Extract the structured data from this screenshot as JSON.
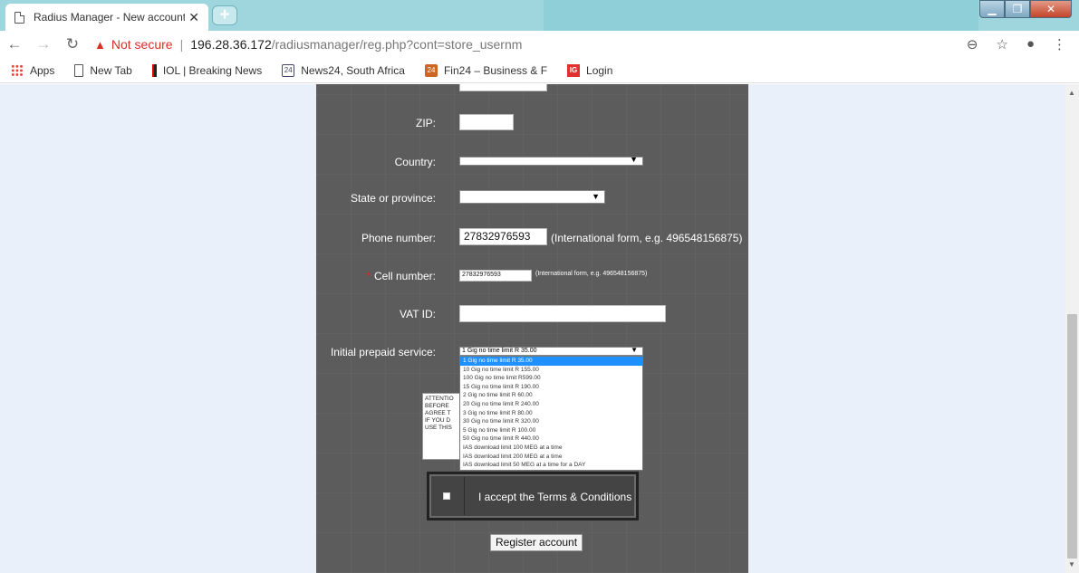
{
  "browser": {
    "tab_title": "Radius Manager - New account",
    "url_security": "Not secure",
    "url_host": "196.28.36.172",
    "url_path": "/radiusmanager/reg.php?cont=store_usernm",
    "bookmarks": [
      "Apps",
      "New Tab",
      "IOL | Breaking News",
      "News24, South Africa",
      "Fin24 – Business & F",
      "Login"
    ]
  },
  "form": {
    "zip_label": "ZIP:",
    "zip_value": "",
    "country_label": "Country:",
    "state_label": "State or province:",
    "phone_label": "Phone number:",
    "phone_value": "27832976593",
    "phone_hint": "(International form, e.g. 496548156875)",
    "cell_label": "Cell number:",
    "cell_value": "27832976593",
    "cell_hint": "(International form, e.g. 496548156875)",
    "vat_label": "VAT ID:",
    "vat_value": "",
    "service_label": "Initial prepaid service:",
    "service_selected": "1 Gig no time limit R 35.00",
    "service_options": [
      "1 Gig no time limit R 35.00",
      "10 Gig no time limit R 155.00",
      "100 Gig no time limit R599.00",
      "15 Gig no time limit R 190.00",
      "2 Gig no time limit R 60.00",
      "20 Gig no time limit R 240.00",
      "3 Gig no time limit R 80.00",
      "30 Gig no time limit R 320.00",
      "5 Gig no time limit R 100.00",
      "50 Gig no time limit R 440.00",
      "IAS download limit 100 MEG at a time",
      "IAS download limit 200 MEG at a time",
      "IAS download limit 50 MEG at a time for a DAY"
    ],
    "attention_lines": [
      "ATTENTIO",
      "BEFORE",
      "AGREE T",
      "IF YOU D",
      "USE THIS"
    ],
    "terms_label": "I accept the Terms & Conditions",
    "register_label": "Register account"
  }
}
